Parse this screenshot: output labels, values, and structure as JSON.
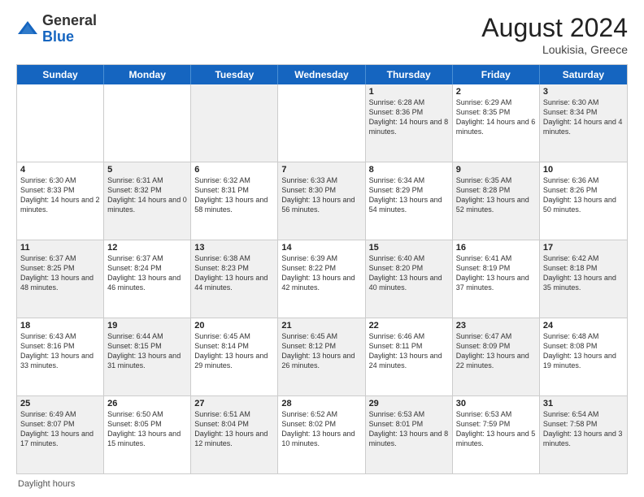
{
  "logo": {
    "general": "General",
    "blue": "Blue"
  },
  "title": {
    "month_year": "August 2024",
    "location": "Loukisia, Greece"
  },
  "days_of_week": [
    "Sunday",
    "Monday",
    "Tuesday",
    "Wednesday",
    "Thursday",
    "Friday",
    "Saturday"
  ],
  "footer": {
    "daylight_label": "Daylight hours"
  },
  "weeks": [
    [
      {
        "day": "",
        "info": "",
        "shaded": false
      },
      {
        "day": "",
        "info": "",
        "shaded": false
      },
      {
        "day": "",
        "info": "",
        "shaded": true
      },
      {
        "day": "",
        "info": "",
        "shaded": false
      },
      {
        "day": "1",
        "info": "Sunrise: 6:28 AM\nSunset: 8:36 PM\nDaylight: 14 hours and 8 minutes.",
        "shaded": true
      },
      {
        "day": "2",
        "info": "Sunrise: 6:29 AM\nSunset: 8:35 PM\nDaylight: 14 hours and 6 minutes.",
        "shaded": false
      },
      {
        "day": "3",
        "info": "Sunrise: 6:30 AM\nSunset: 8:34 PM\nDaylight: 14 hours and 4 minutes.",
        "shaded": true
      }
    ],
    [
      {
        "day": "4",
        "info": "Sunrise: 6:30 AM\nSunset: 8:33 PM\nDaylight: 14 hours and 2 minutes.",
        "shaded": false
      },
      {
        "day": "5",
        "info": "Sunrise: 6:31 AM\nSunset: 8:32 PM\nDaylight: 14 hours and 0 minutes.",
        "shaded": true
      },
      {
        "day": "6",
        "info": "Sunrise: 6:32 AM\nSunset: 8:31 PM\nDaylight: 13 hours and 58 minutes.",
        "shaded": false
      },
      {
        "day": "7",
        "info": "Sunrise: 6:33 AM\nSunset: 8:30 PM\nDaylight: 13 hours and 56 minutes.",
        "shaded": true
      },
      {
        "day": "8",
        "info": "Sunrise: 6:34 AM\nSunset: 8:29 PM\nDaylight: 13 hours and 54 minutes.",
        "shaded": false
      },
      {
        "day": "9",
        "info": "Sunrise: 6:35 AM\nSunset: 8:28 PM\nDaylight: 13 hours and 52 minutes.",
        "shaded": true
      },
      {
        "day": "10",
        "info": "Sunrise: 6:36 AM\nSunset: 8:26 PM\nDaylight: 13 hours and 50 minutes.",
        "shaded": false
      }
    ],
    [
      {
        "day": "11",
        "info": "Sunrise: 6:37 AM\nSunset: 8:25 PM\nDaylight: 13 hours and 48 minutes.",
        "shaded": true
      },
      {
        "day": "12",
        "info": "Sunrise: 6:37 AM\nSunset: 8:24 PM\nDaylight: 13 hours and 46 minutes.",
        "shaded": false
      },
      {
        "day": "13",
        "info": "Sunrise: 6:38 AM\nSunset: 8:23 PM\nDaylight: 13 hours and 44 minutes.",
        "shaded": true
      },
      {
        "day": "14",
        "info": "Sunrise: 6:39 AM\nSunset: 8:22 PM\nDaylight: 13 hours and 42 minutes.",
        "shaded": false
      },
      {
        "day": "15",
        "info": "Sunrise: 6:40 AM\nSunset: 8:20 PM\nDaylight: 13 hours and 40 minutes.",
        "shaded": true
      },
      {
        "day": "16",
        "info": "Sunrise: 6:41 AM\nSunset: 8:19 PM\nDaylight: 13 hours and 37 minutes.",
        "shaded": false
      },
      {
        "day": "17",
        "info": "Sunrise: 6:42 AM\nSunset: 8:18 PM\nDaylight: 13 hours and 35 minutes.",
        "shaded": true
      }
    ],
    [
      {
        "day": "18",
        "info": "Sunrise: 6:43 AM\nSunset: 8:16 PM\nDaylight: 13 hours and 33 minutes.",
        "shaded": false
      },
      {
        "day": "19",
        "info": "Sunrise: 6:44 AM\nSunset: 8:15 PM\nDaylight: 13 hours and 31 minutes.",
        "shaded": true
      },
      {
        "day": "20",
        "info": "Sunrise: 6:45 AM\nSunset: 8:14 PM\nDaylight: 13 hours and 29 minutes.",
        "shaded": false
      },
      {
        "day": "21",
        "info": "Sunrise: 6:45 AM\nSunset: 8:12 PM\nDaylight: 13 hours and 26 minutes.",
        "shaded": true
      },
      {
        "day": "22",
        "info": "Sunrise: 6:46 AM\nSunset: 8:11 PM\nDaylight: 13 hours and 24 minutes.",
        "shaded": false
      },
      {
        "day": "23",
        "info": "Sunrise: 6:47 AM\nSunset: 8:09 PM\nDaylight: 13 hours and 22 minutes.",
        "shaded": true
      },
      {
        "day": "24",
        "info": "Sunrise: 6:48 AM\nSunset: 8:08 PM\nDaylight: 13 hours and 19 minutes.",
        "shaded": false
      }
    ],
    [
      {
        "day": "25",
        "info": "Sunrise: 6:49 AM\nSunset: 8:07 PM\nDaylight: 13 hours and 17 minutes.",
        "shaded": true
      },
      {
        "day": "26",
        "info": "Sunrise: 6:50 AM\nSunset: 8:05 PM\nDaylight: 13 hours and 15 minutes.",
        "shaded": false
      },
      {
        "day": "27",
        "info": "Sunrise: 6:51 AM\nSunset: 8:04 PM\nDaylight: 13 hours and 12 minutes.",
        "shaded": true
      },
      {
        "day": "28",
        "info": "Sunrise: 6:52 AM\nSunset: 8:02 PM\nDaylight: 13 hours and 10 minutes.",
        "shaded": false
      },
      {
        "day": "29",
        "info": "Sunrise: 6:53 AM\nSunset: 8:01 PM\nDaylight: 13 hours and 8 minutes.",
        "shaded": true
      },
      {
        "day": "30",
        "info": "Sunrise: 6:53 AM\nSunset: 7:59 PM\nDaylight: 13 hours and 5 minutes.",
        "shaded": false
      },
      {
        "day": "31",
        "info": "Sunrise: 6:54 AM\nSunset: 7:58 PM\nDaylight: 13 hours and 3 minutes.",
        "shaded": true
      }
    ]
  ]
}
